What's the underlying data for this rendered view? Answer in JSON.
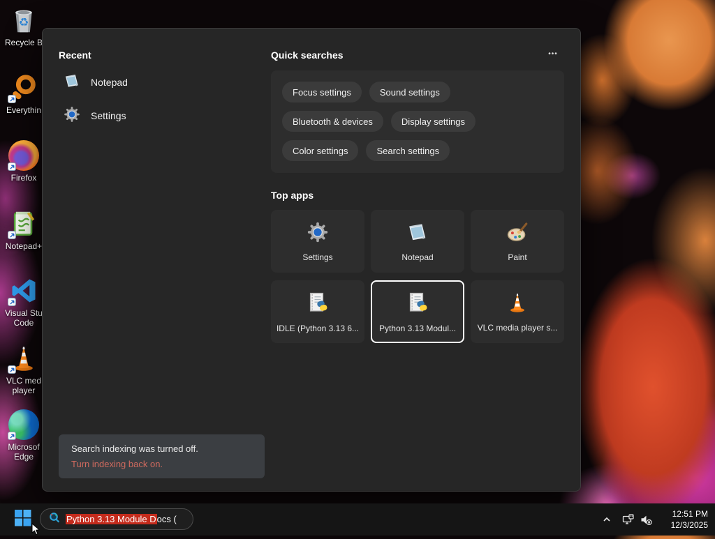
{
  "desktop": {
    "icons": [
      {
        "label": "Recycle B"
      },
      {
        "label": "Everythin"
      },
      {
        "label": "Firefox"
      },
      {
        "label": "Notepad+"
      },
      {
        "label": "Visual Stu Code"
      },
      {
        "label": "VLC med player"
      },
      {
        "label": "Microsof Edge"
      }
    ]
  },
  "panel": {
    "recent": {
      "title": "Recent",
      "items": [
        {
          "label": "Notepad"
        },
        {
          "label": "Settings"
        }
      ]
    },
    "quick_searches": {
      "title": "Quick searches",
      "more_label": "•••",
      "pills": [
        {
          "label": "Focus settings"
        },
        {
          "label": "Sound settings"
        },
        {
          "label": "Bluetooth & devices"
        },
        {
          "label": "Display settings"
        },
        {
          "label": "Color settings"
        },
        {
          "label": "Search settings"
        }
      ]
    },
    "top_apps": {
      "title": "Top apps",
      "tiles": [
        {
          "label": "Settings"
        },
        {
          "label": "Notepad"
        },
        {
          "label": "Paint"
        },
        {
          "label": "IDLE (Python 3.13 6..."
        },
        {
          "label": "Python 3.13 Modul...",
          "selected": true
        },
        {
          "label": "VLC media player s..."
        }
      ]
    },
    "toast": {
      "message": "Search indexing was turned off.",
      "action": "Turn indexing back on."
    }
  },
  "taskbar": {
    "search": {
      "text_selected": "Python 3.13 Module D",
      "text_rest": "ocs ("
    },
    "clock": {
      "time": "12:51 PM",
      "date": "12/3/2025"
    }
  },
  "colors": {
    "selection_red": "#c42b1c",
    "toast_link": "#cf6a5e",
    "accent_blue": "#3aa3f0"
  }
}
